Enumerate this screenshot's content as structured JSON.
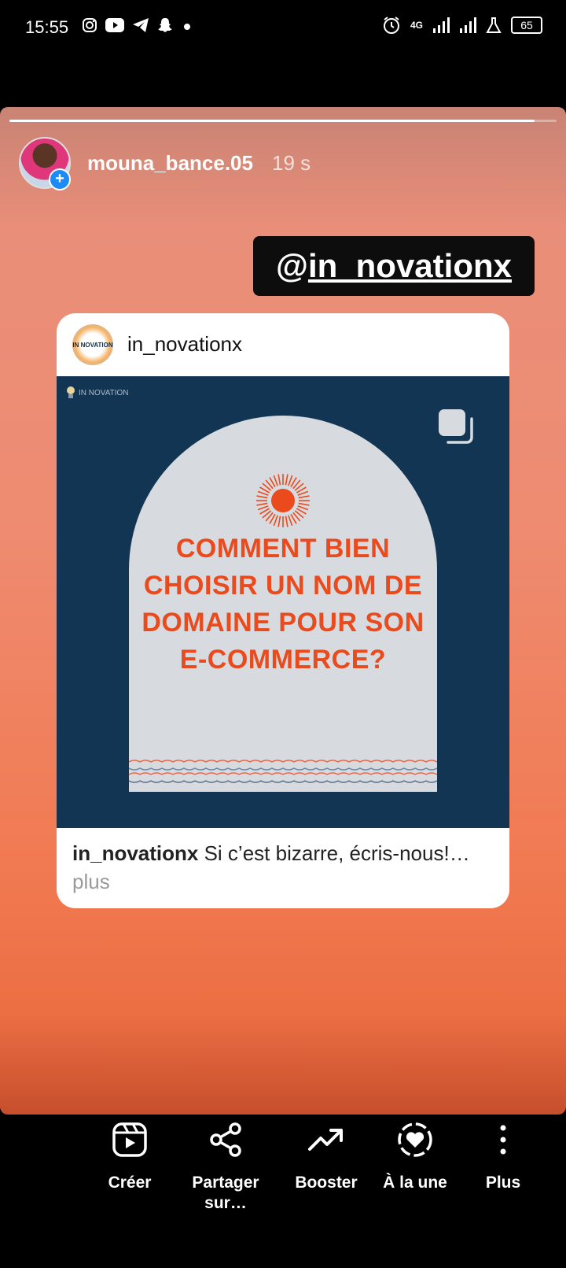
{
  "status_bar": {
    "time": "15:55",
    "left_icons": [
      "instagram-icon",
      "youtube-icon",
      "telegram-icon",
      "snapchat-icon",
      "dot-icon"
    ],
    "network": "4G",
    "battery": "65"
  },
  "story": {
    "username": "mouna_bance.05",
    "time_ago": "19 s",
    "progress": 0.96,
    "mention_at": "@",
    "mention_handle": "in_novationx"
  },
  "post_card": {
    "handle": "in_novationx",
    "logo_text": "IN NOVATION",
    "headline": "COMMENT BIEN CHOISIR UN NOM DE DOMAINE POUR SON E-COMMERCE?",
    "caption_user": "in_novationx",
    "caption_text": "Si c’est bizarre, écris-nous!…",
    "caption_more": "plus",
    "colors": {
      "background": "#113552",
      "arch": "#d7dbe0",
      "headline": "#ea4a1c"
    }
  },
  "actions": [
    {
      "label": "Créer",
      "icon": "reels-icon"
    },
    {
      "label": "Partager sur…",
      "icon": "share-icon"
    },
    {
      "label": "Booster",
      "icon": "trending-icon"
    },
    {
      "label": "À la une",
      "icon": "highlight-heart-icon"
    },
    {
      "label": "Plus",
      "icon": "more-vertical-icon"
    }
  ]
}
